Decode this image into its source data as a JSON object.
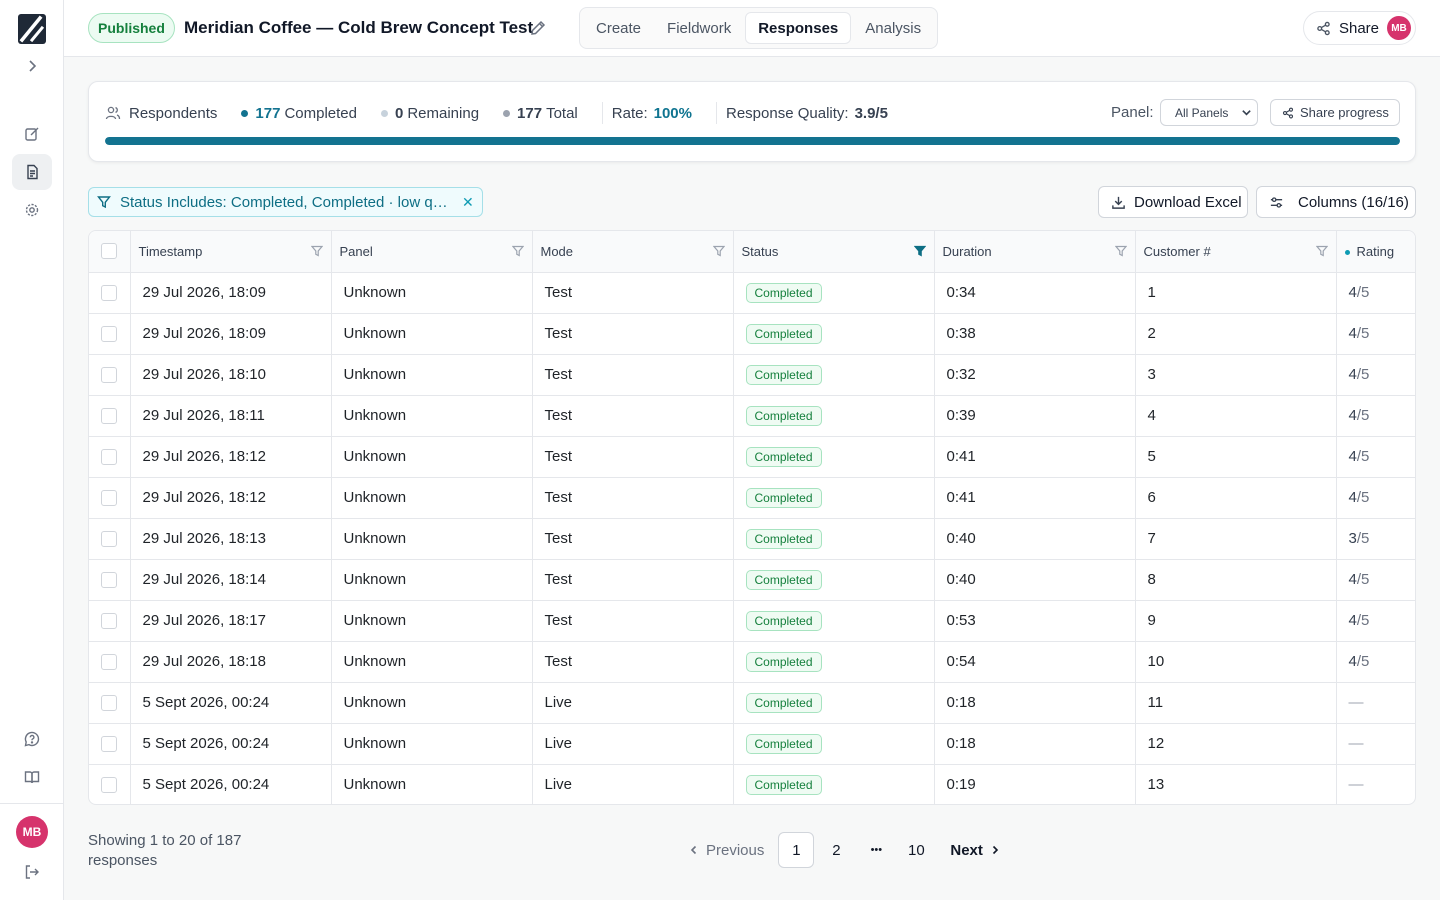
{
  "colors": {
    "accent": "#137390",
    "published": "#15803d",
    "avatar": "#d6336c"
  },
  "header": {
    "status_badge": "Published",
    "title": "Meridian Coffee — Cold Brew Concept Test",
    "tabs": [
      {
        "label": "Create"
      },
      {
        "label": "Fieldwork"
      },
      {
        "label": "Responses",
        "active": true
      },
      {
        "label": "Analysis"
      }
    ],
    "share_label": "Share",
    "avatar_initials": "MB"
  },
  "sidebar": {
    "avatar_initials": "MB",
    "icons": [
      "logo-icon",
      "chevron-right-icon",
      "edit-icon",
      "document-icon",
      "gear-icon",
      "help-icon",
      "book-icon",
      "logout-icon"
    ]
  },
  "progress": {
    "respondents_label": "Respondents",
    "completed_value": "177",
    "completed_label": "Completed",
    "remaining_value": "0",
    "remaining_label": "Remaining",
    "total_value": "177",
    "total_label": "Total",
    "rate_label": "Rate:",
    "rate_value": "100%",
    "quality_label": "Response Quality:",
    "quality_value": "3.9/5",
    "panel_label": "Panel:",
    "panel_selected": "All Panels",
    "share_progress_label": "Share progress",
    "progress_fraction": 1.0
  },
  "filter": {
    "chip_text": "Status Includes: Completed, Completed · low quality"
  },
  "actions": {
    "download_label": "Download Excel",
    "columns_label": "Columns (16/16)"
  },
  "table": {
    "headers": [
      "Timestamp",
      "Panel",
      "Mode",
      "Status",
      "Duration",
      "Customer #",
      "Rating"
    ],
    "rows": [
      {
        "timestamp": "29 Jul 2026, 18:09",
        "panel": "Unknown",
        "mode": "Test",
        "status": "Completed",
        "duration": "0:34",
        "customer": "1",
        "rating": "4",
        "rating_max": "/5"
      },
      {
        "timestamp": "29 Jul 2026, 18:09",
        "panel": "Unknown",
        "mode": "Test",
        "status": "Completed",
        "duration": "0:38",
        "customer": "2",
        "rating": "4",
        "rating_max": "/5"
      },
      {
        "timestamp": "29 Jul 2026, 18:10",
        "panel": "Unknown",
        "mode": "Test",
        "status": "Completed",
        "duration": "0:32",
        "customer": "3",
        "rating": "4",
        "rating_max": "/5"
      },
      {
        "timestamp": "29 Jul 2026, 18:11",
        "panel": "Unknown",
        "mode": "Test",
        "status": "Completed",
        "duration": "0:39",
        "customer": "4",
        "rating": "4",
        "rating_max": "/5"
      },
      {
        "timestamp": "29 Jul 2026, 18:12",
        "panel": "Unknown",
        "mode": "Test",
        "status": "Completed",
        "duration": "0:41",
        "customer": "5",
        "rating": "4",
        "rating_max": "/5"
      },
      {
        "timestamp": "29 Jul 2026, 18:12",
        "panel": "Unknown",
        "mode": "Test",
        "status": "Completed",
        "duration": "0:41",
        "customer": "6",
        "rating": "4",
        "rating_max": "/5"
      },
      {
        "timestamp": "29 Jul 2026, 18:13",
        "panel": "Unknown",
        "mode": "Test",
        "status": "Completed",
        "duration": "0:40",
        "customer": "7",
        "rating": "3",
        "rating_max": "/5"
      },
      {
        "timestamp": "29 Jul 2026, 18:14",
        "panel": "Unknown",
        "mode": "Test",
        "status": "Completed",
        "duration": "0:40",
        "customer": "8",
        "rating": "4",
        "rating_max": "/5"
      },
      {
        "timestamp": "29 Jul 2026, 18:17",
        "panel": "Unknown",
        "mode": "Test",
        "status": "Completed",
        "duration": "0:53",
        "customer": "9",
        "rating": "4",
        "rating_max": "/5"
      },
      {
        "timestamp": "29 Jul 2026, 18:18",
        "panel": "Unknown",
        "mode": "Test",
        "status": "Completed",
        "duration": "0:54",
        "customer": "10",
        "rating": "4",
        "rating_max": "/5"
      },
      {
        "timestamp": "5 Sept 2026, 00:24",
        "panel": "Unknown",
        "mode": "Live",
        "status": "Completed",
        "duration": "0:18",
        "customer": "11",
        "rating": "—",
        "rating_max": ""
      },
      {
        "timestamp": "5 Sept 2026, 00:24",
        "panel": "Unknown",
        "mode": "Live",
        "status": "Completed",
        "duration": "0:18",
        "customer": "12",
        "rating": "—",
        "rating_max": ""
      },
      {
        "timestamp": "5 Sept 2026, 00:24",
        "panel": "Unknown",
        "mode": "Live",
        "status": "Completed",
        "duration": "0:19",
        "customer": "13",
        "rating": "—",
        "rating_max": ""
      }
    ]
  },
  "footer": {
    "showing_text": "Showing 1 to 20 of 187 responses",
    "prev_label": "Previous",
    "next_label": "Next",
    "pages": [
      "1",
      "2",
      "•••",
      "10"
    ],
    "current_page": "1"
  }
}
